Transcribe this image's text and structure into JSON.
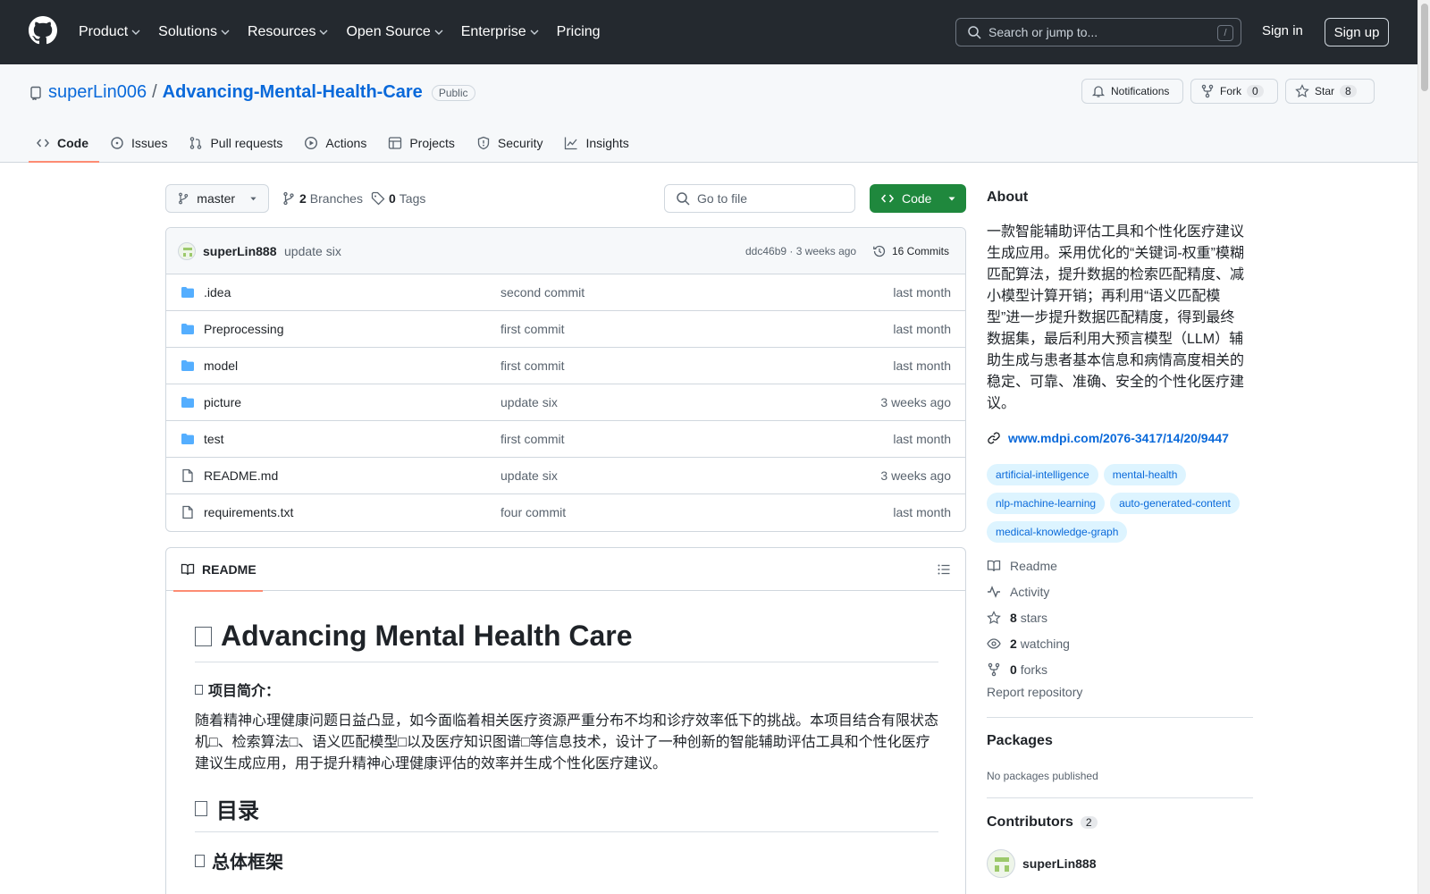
{
  "header": {
    "nav": [
      "Product",
      "Solutions",
      "Resources",
      "Open Source",
      "Enterprise",
      "Pricing"
    ],
    "search_placeholder": "Search or jump to...",
    "search_shortcut": "/",
    "sign_in": "Sign in",
    "sign_up": "Sign up"
  },
  "repo": {
    "owner": "superLin006",
    "separator": "/",
    "name": "Advancing-Mental-Health-Care",
    "visibility": "Public",
    "notifications_label": "Notifications",
    "fork_label": "Fork",
    "fork_count": "0",
    "star_label": "Star",
    "star_count": "8"
  },
  "tabs": [
    {
      "label": "Code",
      "icon": "code-icon"
    },
    {
      "label": "Issues",
      "icon": "issue-icon"
    },
    {
      "label": "Pull requests",
      "icon": "pull-request-icon"
    },
    {
      "label": "Actions",
      "icon": "play-icon"
    },
    {
      "label": "Projects",
      "icon": "table-icon"
    },
    {
      "label": "Security",
      "icon": "shield-icon"
    },
    {
      "label": "Insights",
      "icon": "graph-icon"
    }
  ],
  "toolbar": {
    "branch": "master",
    "branches_count": "2",
    "branches_label": "Branches",
    "tags_count": "0",
    "tags_label": "Tags",
    "goto_placeholder": "Go to file",
    "code_button": "Code"
  },
  "latest_commit": {
    "author": "superLin888",
    "message": "update six",
    "meta": "ddc46b9 · 3 weeks ago",
    "commits": "16 Commits"
  },
  "files": [
    {
      "name": ".idea",
      "type": "folder",
      "message": "second commit",
      "date": "last month"
    },
    {
      "name": "Preprocessing",
      "type": "folder",
      "message": "first commit",
      "date": "last month"
    },
    {
      "name": "model",
      "type": "folder",
      "message": "first commit",
      "date": "last month"
    },
    {
      "name": "picture",
      "type": "folder",
      "message": "update six",
      "date": "3 weeks ago"
    },
    {
      "name": "test",
      "type": "folder",
      "message": "first commit",
      "date": "last month"
    },
    {
      "name": "README.md",
      "type": "file",
      "message": "update six",
      "date": "3 weeks ago"
    },
    {
      "name": "requirements.txt",
      "type": "file",
      "message": "four commit",
      "date": "last month"
    }
  ],
  "readme": {
    "tab_label": "README",
    "h1": "Advancing Mental Health Care",
    "intro_heading": "项目简介：",
    "intro_text": "随着精神心理健康问题日益凸显，如今面临着相关医疗资源严重分布不均和诊疗效率低下的挑战。本项目结合有限状态机□、检索算法□、语义匹配模型□以及医疗知识图谱□等信息技术，设计了一种创新的智能辅助评估工具和个性化医疗建议生成应用，用于提升精神心理健康评估的效率并生成个性化医疗建议。",
    "toc_heading": "目录",
    "framework_heading": "总体框架"
  },
  "about": {
    "title": "About",
    "description": "一款智能辅助评估工具和个性化医疗建议生成应用。采用优化的“关键词-权重”模糊匹配算法，提升数据的检索匹配精度、减小模型计算开销；再利用“语义匹配模型”进一步提升数据匹配精度，得到最终数据集，最后利用大预言模型（LLM）辅助生成与患者基本信息和病情高度相关的稳定、可靠、准确、安全的个性化医疗建议。",
    "link": "www.mdpi.com/2076-3417/14/20/9447",
    "topics": [
      "artificial-intelligence",
      "mental-health",
      "nlp-machine-learning",
      "auto-generated-content",
      "medical-knowledge-graph"
    ],
    "readme_label": "Readme",
    "activity_label": "Activity",
    "stars_count": "8",
    "stars_label": "stars",
    "watching_count": "2",
    "watching_label": "watching",
    "forks_count": "0",
    "forks_label": "forks",
    "report": "Report repository"
  },
  "packages": {
    "title": "Packages",
    "text": "No packages published"
  },
  "contributors": {
    "title": "Contributors",
    "count": "2",
    "first": "superLin888"
  }
}
